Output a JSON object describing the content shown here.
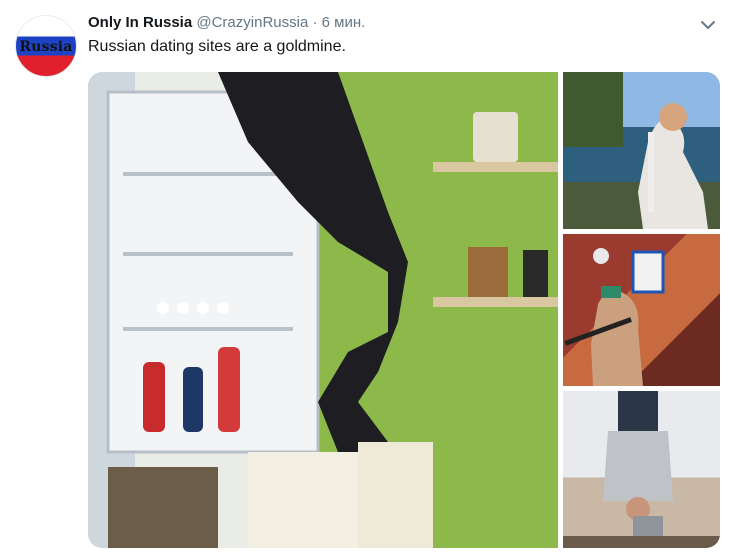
{
  "tweet": {
    "avatar_text": "Russia",
    "author_name": "Only In Russia",
    "handle": "@CrazyinRussia",
    "separator": "·",
    "time": "6 мин.",
    "text": "Russian dating sites are a goldmine.",
    "menu_icon": "chevron-down-icon"
  },
  "media": {
    "photos": [
      {
        "name": "fridge-photo"
      },
      {
        "name": "lake-fishing-photo"
      },
      {
        "name": "rug-room-photo"
      },
      {
        "name": "upside-down-photo"
      }
    ]
  },
  "colors": {
    "text": "#14171a",
    "secondary": "#657786",
    "flag_white": "#ffffff",
    "flag_blue": "#1d43c4",
    "flag_red": "#e0202d"
  }
}
